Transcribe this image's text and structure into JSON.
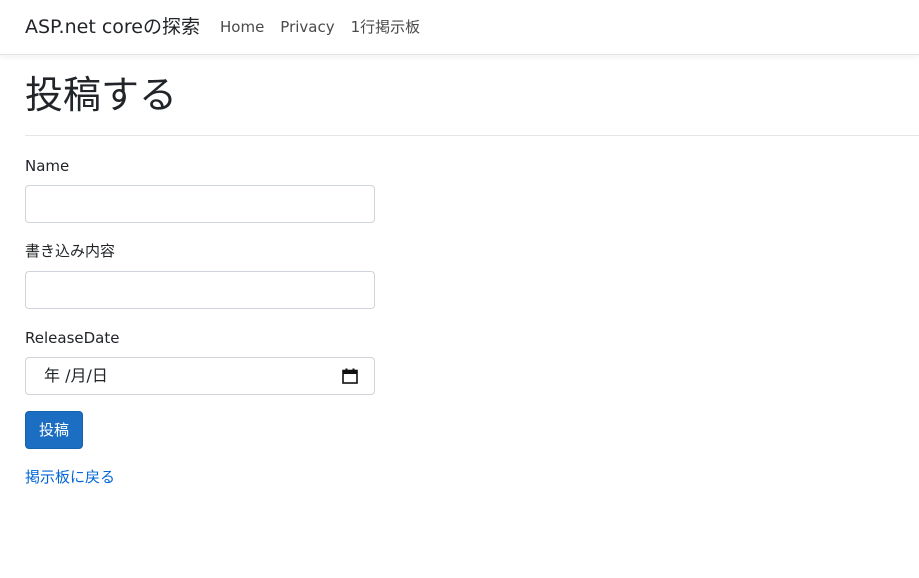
{
  "navbar": {
    "brand": "ASP.net coreの探索",
    "links": [
      "Home",
      "Privacy",
      "1行掲示板"
    ]
  },
  "page": {
    "title": "投稿する"
  },
  "form": {
    "name_label": "Name",
    "name_value": "",
    "content_label": "書き込み内容",
    "content_value": "",
    "release_label": "ReleaseDate",
    "release_placeholder": "年 /月/日",
    "submit_label": "投稿"
  },
  "footer": {
    "back_link": "掲示板に戻る"
  },
  "icons": {
    "calendar": "calendar-icon"
  },
  "colors": {
    "primary_button": "#1b6ec2",
    "link": "#0366d6",
    "border": "#ced4da"
  }
}
